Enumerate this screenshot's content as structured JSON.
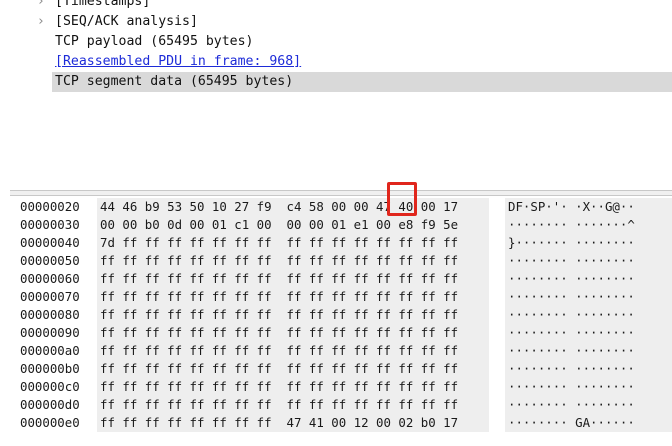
{
  "details": {
    "rows": [
      {
        "chevron": "›",
        "label": "[Timestamps]"
      },
      {
        "chevron": "›",
        "label": "[SEQ/ACK analysis]"
      },
      {
        "chevron": "",
        "label": "TCP payload (65495 bytes)"
      },
      {
        "chevron": "",
        "label": "[Reassembled PDU in frame: 968]"
      },
      {
        "chevron": "",
        "label": "TCP segment data (65495 bytes)"
      }
    ]
  },
  "hex_dump": {
    "rows": [
      {
        "offset": "00000020",
        "hex": "44 46 b9 53 50 10 27 f9  c4 58 00 00 47 40 00 17",
        "ascii": "DF·SP·'· ·X··G@··"
      },
      {
        "offset": "00000030",
        "hex": "00 00 b0 0d 00 01 c1 00  00 00 01 e1 00 e8 f9 5e",
        "ascii": "········ ·······^"
      },
      {
        "offset": "00000040",
        "hex": "7d ff ff ff ff ff ff ff  ff ff ff ff ff ff ff ff",
        "ascii": "}······· ········"
      },
      {
        "offset": "00000050",
        "hex": "ff ff ff ff ff ff ff ff  ff ff ff ff ff ff ff ff",
        "ascii": "········ ········"
      },
      {
        "offset": "00000060",
        "hex": "ff ff ff ff ff ff ff ff  ff ff ff ff ff ff ff ff",
        "ascii": "········ ········"
      },
      {
        "offset": "00000070",
        "hex": "ff ff ff ff ff ff ff ff  ff ff ff ff ff ff ff ff",
        "ascii": "········ ········"
      },
      {
        "offset": "00000080",
        "hex": "ff ff ff ff ff ff ff ff  ff ff ff ff ff ff ff ff",
        "ascii": "········ ········"
      },
      {
        "offset": "00000090",
        "hex": "ff ff ff ff ff ff ff ff  ff ff ff ff ff ff ff ff",
        "ascii": "········ ········"
      },
      {
        "offset": "000000a0",
        "hex": "ff ff ff ff ff ff ff ff  ff ff ff ff ff ff ff ff",
        "ascii": "········ ········"
      },
      {
        "offset": "000000b0",
        "hex": "ff ff ff ff ff ff ff ff  ff ff ff ff ff ff ff ff",
        "ascii": "········ ········"
      },
      {
        "offset": "000000c0",
        "hex": "ff ff ff ff ff ff ff ff  ff ff ff ff ff ff ff ff",
        "ascii": "········ ········"
      },
      {
        "offset": "000000d0",
        "hex": "ff ff ff ff ff ff ff ff  ff ff ff ff ff ff ff ff",
        "ascii": "········ ········"
      },
      {
        "offset": "000000e0",
        "hex": "ff ff ff ff ff ff ff ff  47 41 00 12 00 02 b0 17",
        "ascii": "········ GA······"
      }
    ]
  },
  "colors": {
    "selected_row": "#d9d9d9",
    "link": "#1d2bd8",
    "hex_background": "#eeeeee",
    "annotation_box": "#e0261c"
  }
}
